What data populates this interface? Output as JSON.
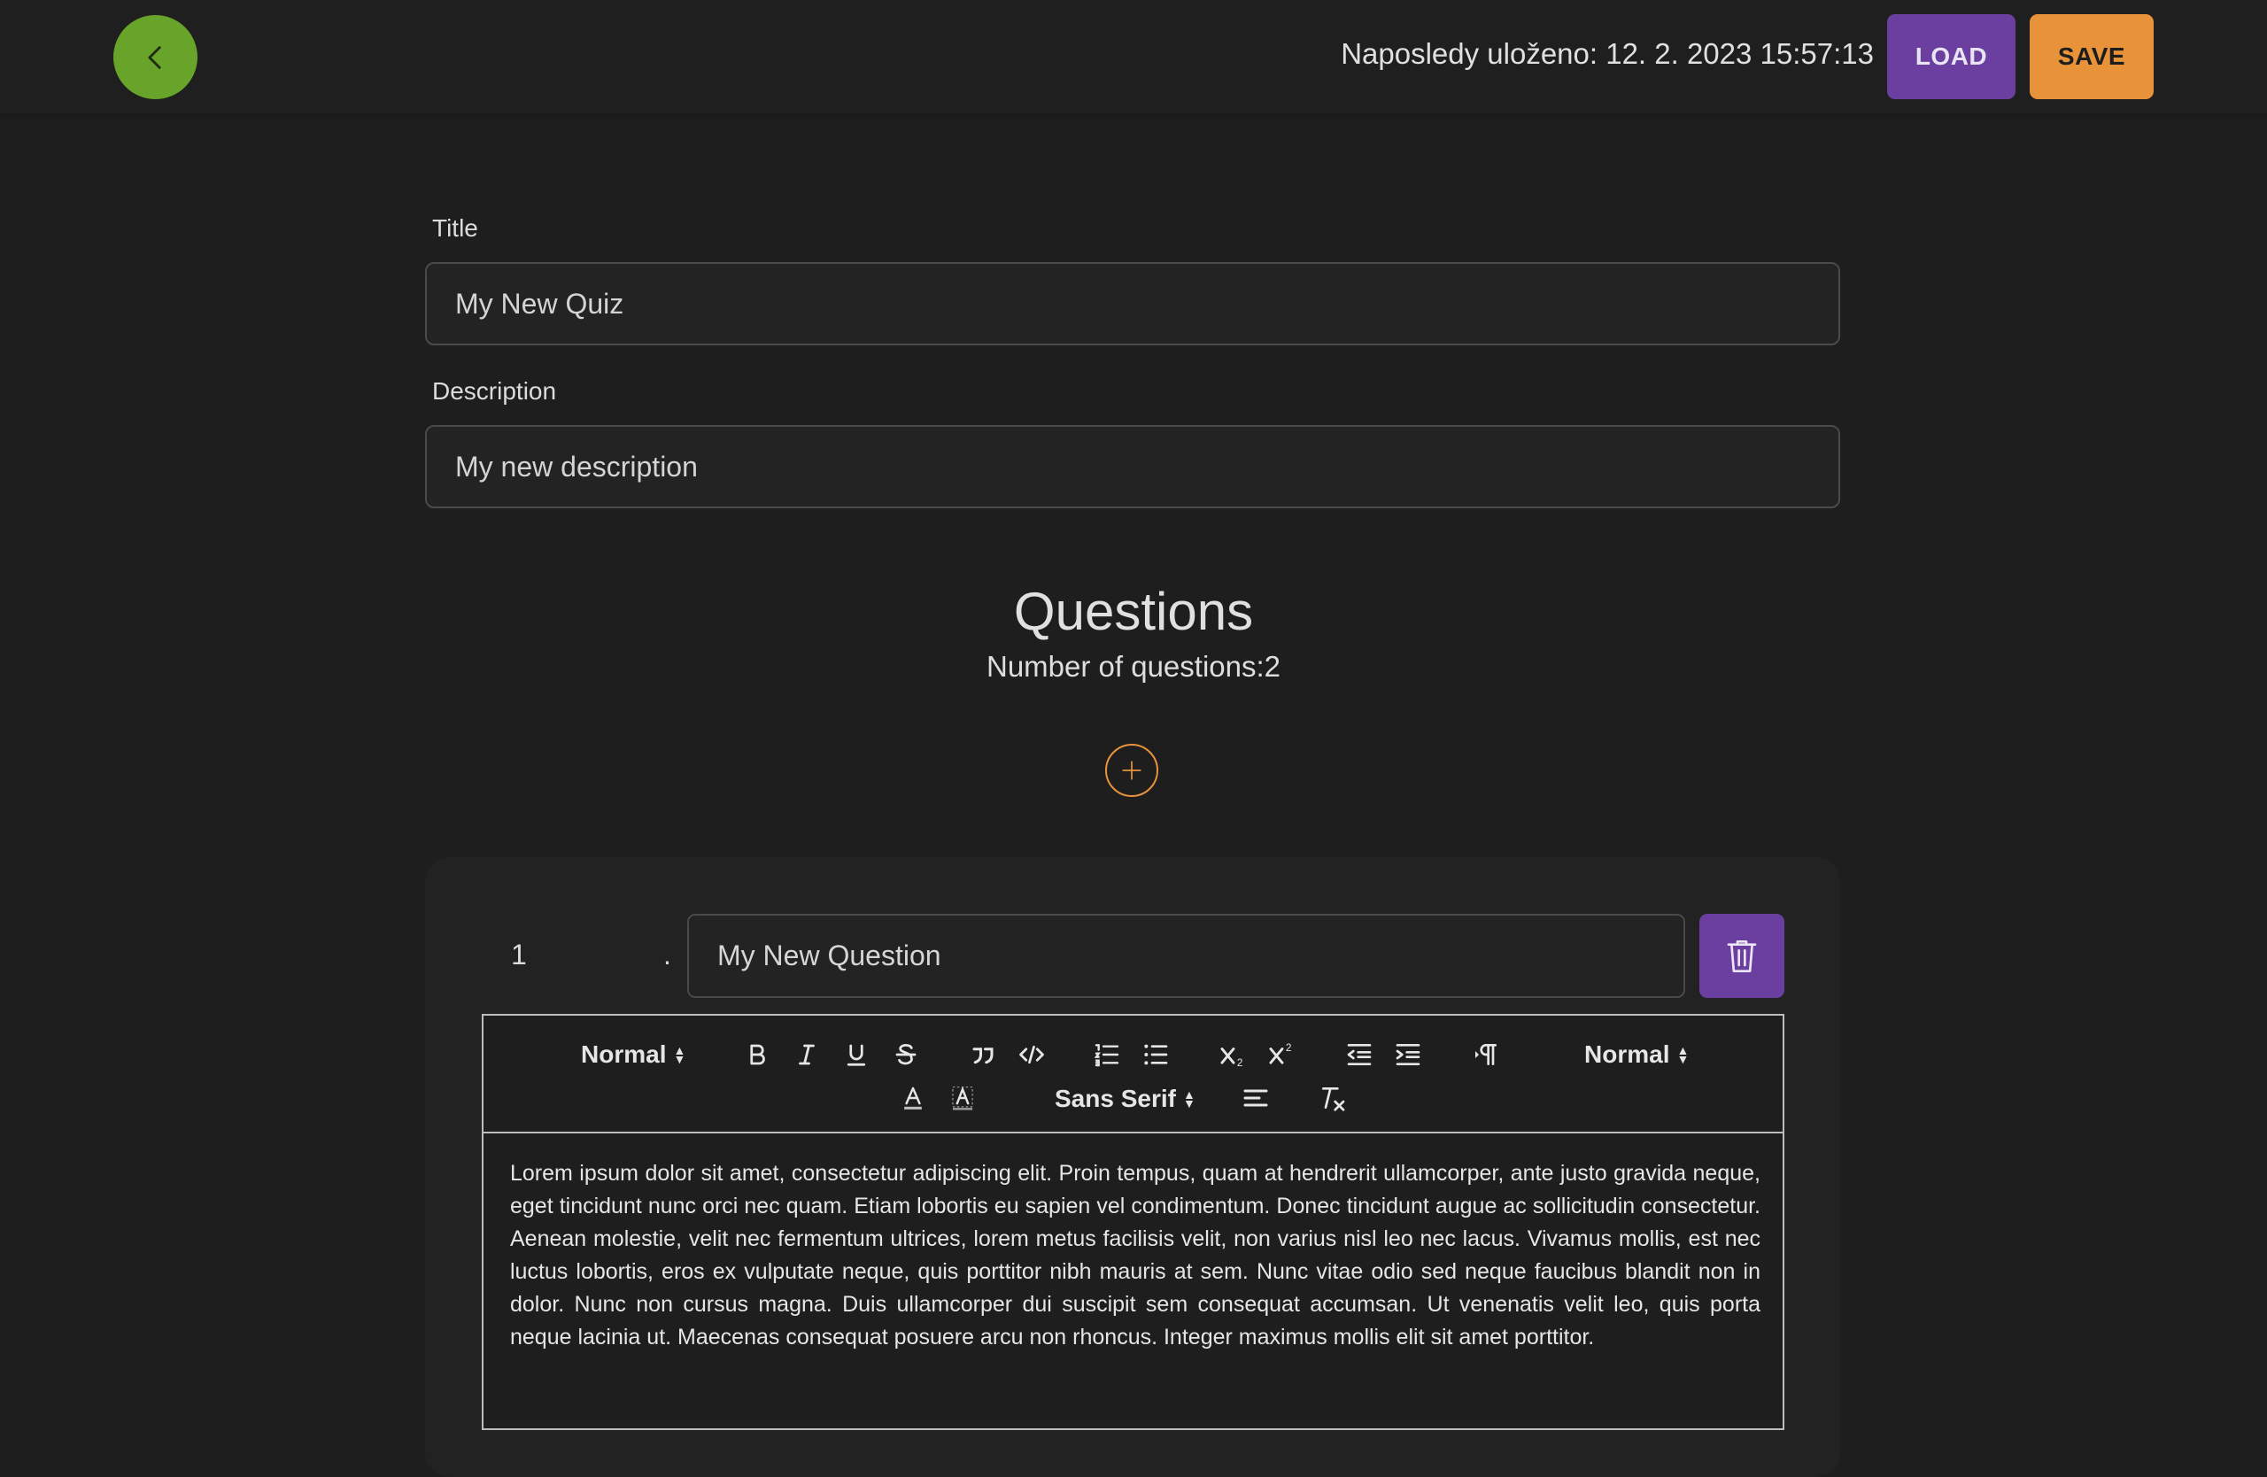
{
  "header": {
    "last_saved": "Naposledy uloženo: 12. 2. 2023 15:57:13",
    "load_label": "LOAD",
    "save_label": "SAVE",
    "back_icon": "chevron-left-icon"
  },
  "form": {
    "title_label": "Title",
    "title_value": "My New Quiz",
    "description_label": "Description",
    "description_value": "My new description"
  },
  "questions": {
    "heading": "Questions",
    "count_text": "Number of questions:2",
    "add_icon": "plus-icon",
    "items": [
      {
        "number": "1",
        "dot": ".",
        "title": "My New Question",
        "delete_icon": "trash-icon",
        "body": "Lorem ipsum dolor sit amet, consectetur adipiscing elit. Proin tempus, quam at hendrerit ullamcorper, ante justo gravida neque, eget tincidunt nunc orci nec quam. Etiam lobortis eu sapien vel condimentum. Donec tincidunt augue ac sollicitudin consectetur. Aenean molestie, velit nec fermentum ultrices, lorem metus facilisis velit, non varius nisl leo nec lacus. Vivamus mollis, est nec luctus lobortis, eros ex vulputate neque, quis porttitor nibh mauris at sem. Nunc vitae odio sed neque faucibus blandit non in dolor. Nunc non cursus magna. Duis ullamcorper dui suscipit sem consequat accumsan. Ut venenatis velit leo, quis porta neque lacinia ut. Maecenas consequat posuere arcu non rhoncus. Integer maximus mollis elit sit amet porttitor."
      }
    ]
  },
  "editor_toolbar": {
    "header_select": "Normal",
    "size_select": "Normal",
    "font_select": "Sans Serif",
    "icons": [
      "bold-icon",
      "italic-icon",
      "underline-icon",
      "strike-icon",
      "blockquote-icon",
      "code-block-icon",
      "ordered-list-icon",
      "bullet-list-icon",
      "subscript-icon",
      "superscript-icon",
      "outdent-icon",
      "indent-icon",
      "direction-icon",
      "text-color-icon",
      "background-color-icon",
      "align-icon",
      "clear-format-icon"
    ]
  },
  "colors": {
    "background": "#1e1e1e",
    "back_button": "#69a42a",
    "load_button": "#6a3fa0",
    "save_button": "#e8923a",
    "add_button_border": "#e8923a",
    "delete_button": "#6a3fa0"
  }
}
